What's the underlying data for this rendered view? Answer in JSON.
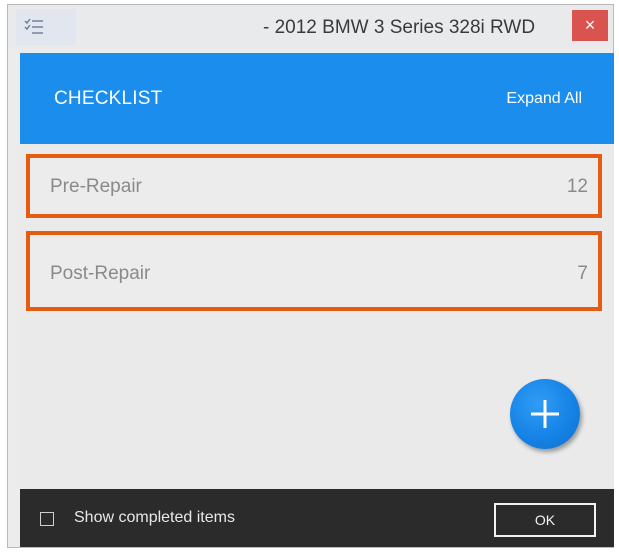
{
  "window": {
    "title": "- 2012 BMW 3 Series 328i RWD",
    "close_glyph": "×"
  },
  "header": {
    "title": "CHECKLIST",
    "expand_all": "Expand All"
  },
  "checklists": [
    {
      "label": "Pre-Repair",
      "count": "12"
    },
    {
      "label": "Post-Repair",
      "count": "7"
    }
  ],
  "footer": {
    "show_completed_label": "Show completed items",
    "show_completed_checked": false,
    "ok_label": "OK"
  },
  "icons": {
    "app": "checklist-icon",
    "add": "plus-icon",
    "close": "close-icon"
  },
  "colors": {
    "header_blue": "#1a8ded",
    "highlight_orange": "#e35c0f",
    "footer_dark": "#2b2b2b",
    "close_red": "#d9534f"
  }
}
